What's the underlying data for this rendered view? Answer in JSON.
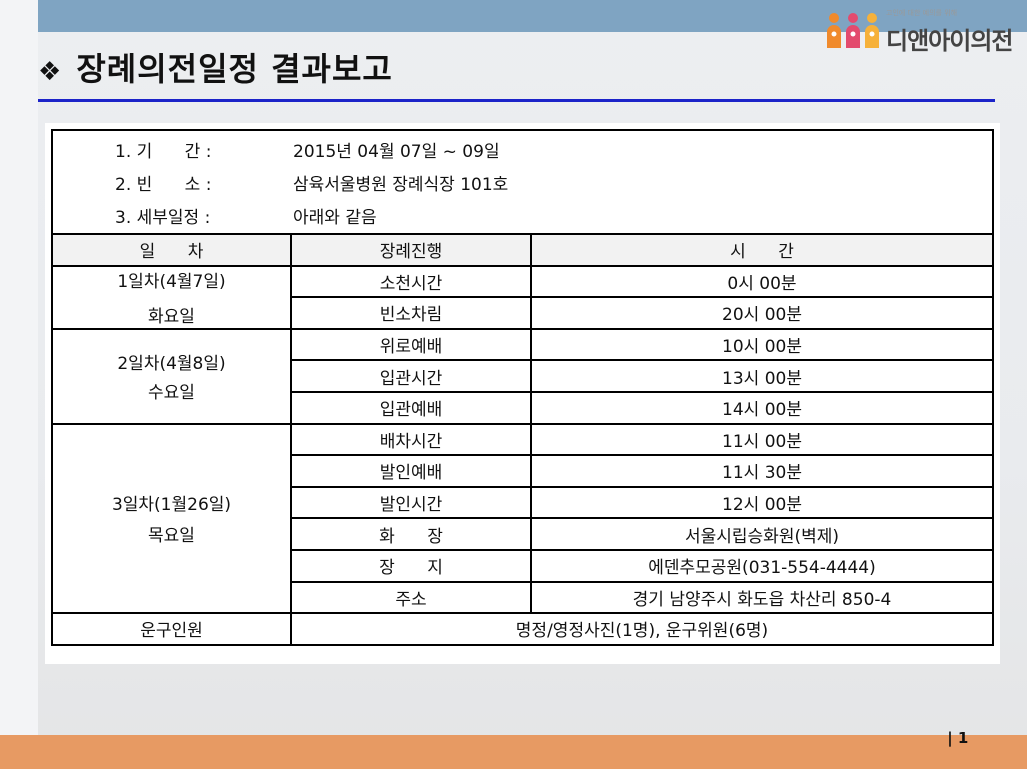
{
  "logo": {
    "small_text": "고인에 대한 예의를 위해",
    "name": "디앤아이의전"
  },
  "title": "장례의전일정 결과보고",
  "info": [
    {
      "key": "1. 기      간 :",
      "value": "2015년 04월 07일 ~ 09일"
    },
    {
      "key": "2. 빈      소 :",
      "value": "삼육서울병원 장례식장 101호"
    },
    {
      "key": "3. 세부일정 :",
      "value": "아래와 같음"
    }
  ],
  "table": {
    "headers": [
      "일      차",
      "장례진행",
      "시      간"
    ],
    "day1": {
      "label": "1일차(4월7일)",
      "weekday": "화요일"
    },
    "day2": {
      "label": "2일차(4월8일)",
      "weekday": "수요일"
    },
    "day3": {
      "label": "3일차(1월26일)",
      "weekday": "목요일"
    },
    "rows": [
      {
        "event": "소천시간",
        "time": "0시 00분"
      },
      {
        "event": "빈소차림",
        "time": "20시 00분"
      },
      {
        "event": "위로예배",
        "time": "10시 00분"
      },
      {
        "event": "입관시간",
        "time": "13시 00분"
      },
      {
        "event": "입관예배",
        "time": "14시 00분"
      },
      {
        "event": "배차시간",
        "time": "11시 00분"
      },
      {
        "event": "발인예배",
        "time": "11시 30분"
      },
      {
        "event": "발인시간",
        "time": "12시 00분"
      },
      {
        "event": "화      장",
        "time": "서울시립승화원(벽제)"
      },
      {
        "event": "장      지",
        "time": "에덴추모공원(031-554-4444)"
      },
      {
        "event": "주소",
        "time": "경기 남양주시 화도읍 차산리 850-4"
      }
    ],
    "footer": {
      "label": "운구인원",
      "value": "명정/영정사진(1명), 운구위원(6명)"
    }
  },
  "page_number": "1",
  "colors": {
    "top_bar": "#7fa4c2",
    "bottom_bar": "#e79a63",
    "title_rule": "#1b23c9"
  }
}
